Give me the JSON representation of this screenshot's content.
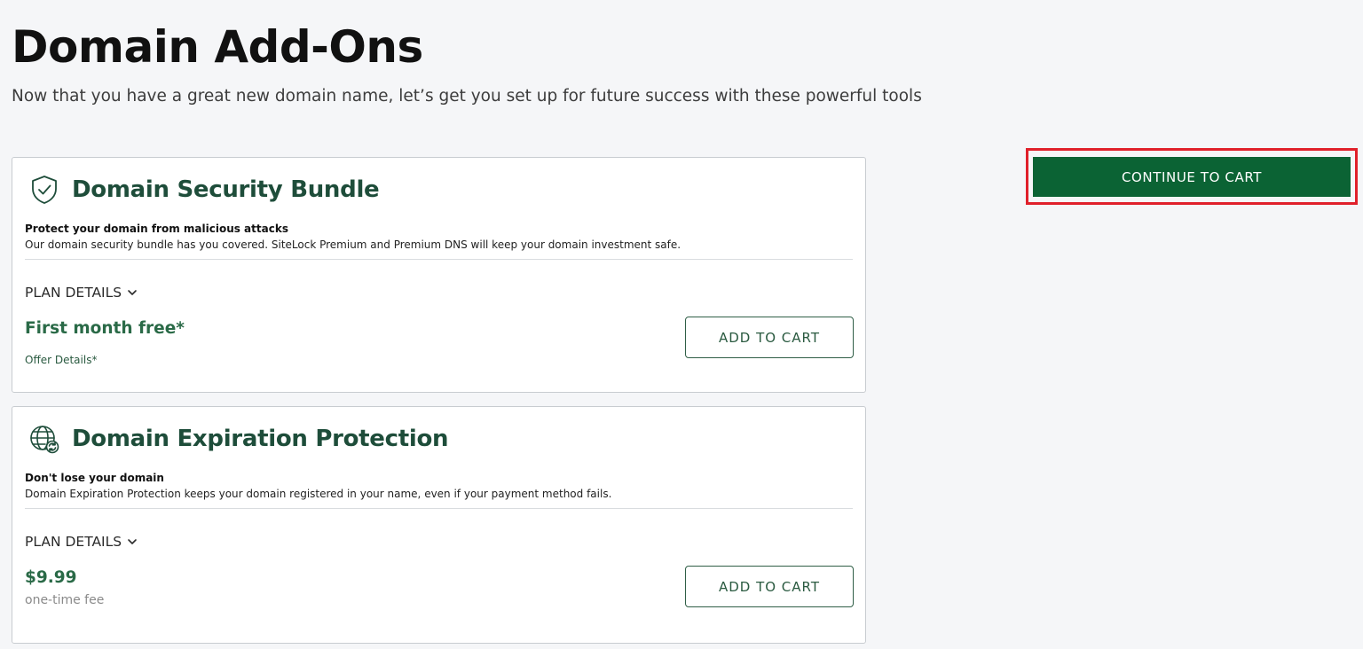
{
  "header": {
    "title": "Domain Add-Ons",
    "subtitle": "Now that you have a great new domain name, let’s get you set up for future success with these powerful tools"
  },
  "continue_button": {
    "label": "CONTINUE TO CART"
  },
  "cards": [
    {
      "icon": "shield-check-icon",
      "title": "Domain Security Bundle",
      "tagline": "Protect your domain from malicious attacks",
      "description": "Our domain security bundle has you covered. SiteLock Premium and Premium DNS will keep your domain investment safe.",
      "plan_details_label": "PLAN DETAILS",
      "price": "First month free*",
      "offer_link": "Offer Details*",
      "add_button_label": "ADD TO CART"
    },
    {
      "icon": "globe-refresh-icon",
      "title": "Domain Expiration Protection",
      "tagline": "Don't lose your domain",
      "description": "Domain Expiration Protection keeps your domain registered in your name, even if your payment method fails.",
      "plan_details_label": "PLAN DETAILS",
      "price": "$9.99",
      "price_note": "one-time fee",
      "add_button_label": "ADD TO CART"
    }
  ],
  "colors": {
    "brand_green": "#0b6334",
    "heading_green": "#1e4d3a",
    "price_green": "#2a6a47",
    "highlight_red": "#e0202a",
    "background": "#f5f6f8"
  }
}
